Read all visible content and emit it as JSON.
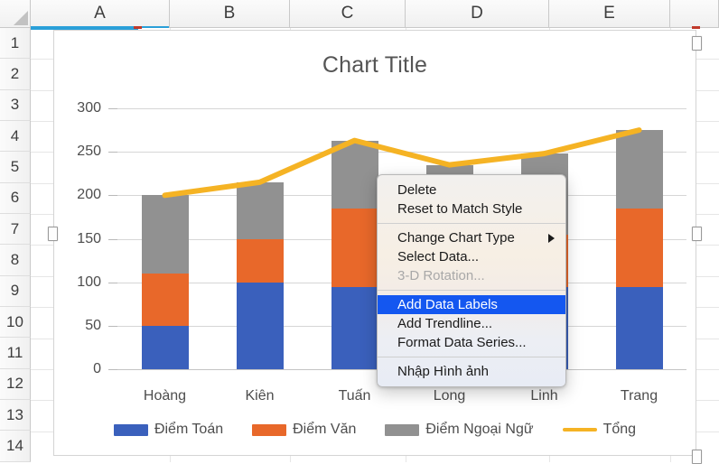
{
  "spreadsheet": {
    "columns": [
      "A",
      "B",
      "C",
      "D",
      "E"
    ],
    "rows": [
      "1",
      "2",
      "3",
      "4",
      "5",
      "6",
      "7",
      "8",
      "9",
      "10",
      "11",
      "12",
      "13",
      "14"
    ],
    "selected_column": "A"
  },
  "chart_data": {
    "type": "bar",
    "subtype": "stacked-column-with-line",
    "title": "Chart Title",
    "xlabel": "",
    "ylabel": "",
    "ylim": [
      0,
      300
    ],
    "yticks": [
      0,
      50,
      100,
      150,
      200,
      250,
      300
    ],
    "grid": true,
    "legend_position": "bottom",
    "categories": [
      "Hoàng",
      "Kiên",
      "Tuấn",
      "Long",
      "Linh",
      "Trang"
    ],
    "series": [
      {
        "name": "Điểm Toán",
        "type": "bar",
        "stack": "scores",
        "color": "#3A60BC",
        "values": [
          50,
          100,
          95,
          90,
          95,
          95
        ]
      },
      {
        "name": "Điểm Văn",
        "type": "bar",
        "stack": "scores",
        "color": "#E8682A",
        "values": [
          60,
          50,
          90,
          65,
          60,
          90
        ]
      },
      {
        "name": "Điểm Ngoại Ngữ",
        "type": "bar",
        "stack": "scores",
        "color": "#919191",
        "values": [
          90,
          65,
          78,
          80,
          93,
          90
        ]
      },
      {
        "name": "Tổng",
        "type": "line",
        "color": "#F5B324",
        "values": [
          200,
          215,
          263,
          235,
          248,
          275
        ]
      }
    ]
  },
  "context_menu": {
    "groups": [
      [
        {
          "label": "Delete",
          "state": "normal"
        },
        {
          "label": "Reset to Match Style",
          "state": "normal"
        }
      ],
      [
        {
          "label": "Change Chart Type",
          "state": "submenu"
        },
        {
          "label": "Select Data...",
          "state": "normal"
        },
        {
          "label": "3-D Rotation...",
          "state": "disabled"
        }
      ],
      [
        {
          "label": "Add Data Labels",
          "state": "highlighted"
        },
        {
          "label": "Add Trendline...",
          "state": "normal"
        },
        {
          "label": "Format Data Series...",
          "state": "normal"
        }
      ],
      [
        {
          "label": "Nhập Hình ảnh",
          "state": "normal"
        }
      ]
    ]
  },
  "colors": {
    "series_blue": "#3A60BC",
    "series_orange": "#E8682A",
    "series_gray": "#919191",
    "series_yellow": "#F5B324",
    "menu_highlight": "#1457F0",
    "selection_blue": "#2A9FD8"
  }
}
